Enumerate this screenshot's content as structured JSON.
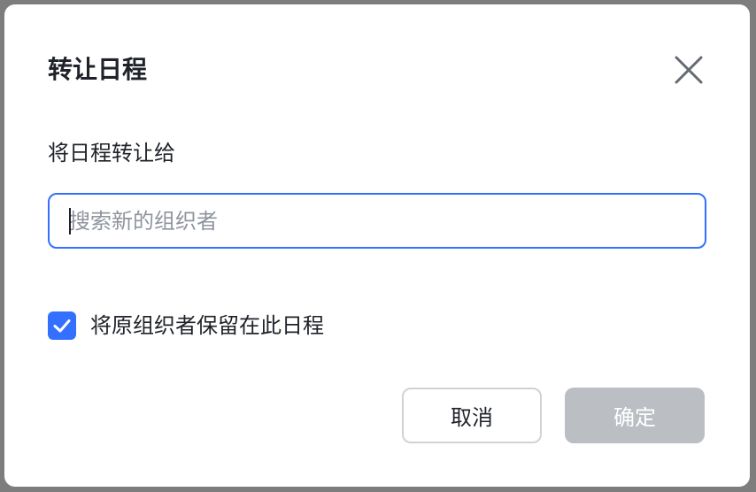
{
  "dialog": {
    "title": "转让日程",
    "field_label": "将日程转让给",
    "search": {
      "placeholder": "搜索新的组织者",
      "value": ""
    },
    "keep_organizer": {
      "label": "将原组织者保留在此日程",
      "checked": true
    },
    "buttons": {
      "cancel_label": "取消",
      "confirm_label": "确定"
    }
  },
  "colors": {
    "accent": "#3370ff",
    "disabled_button": "#bbbfc4",
    "text_primary": "#1f2329",
    "placeholder": "#8f959e"
  },
  "icons": {
    "close": "close-icon",
    "check": "check-icon"
  }
}
